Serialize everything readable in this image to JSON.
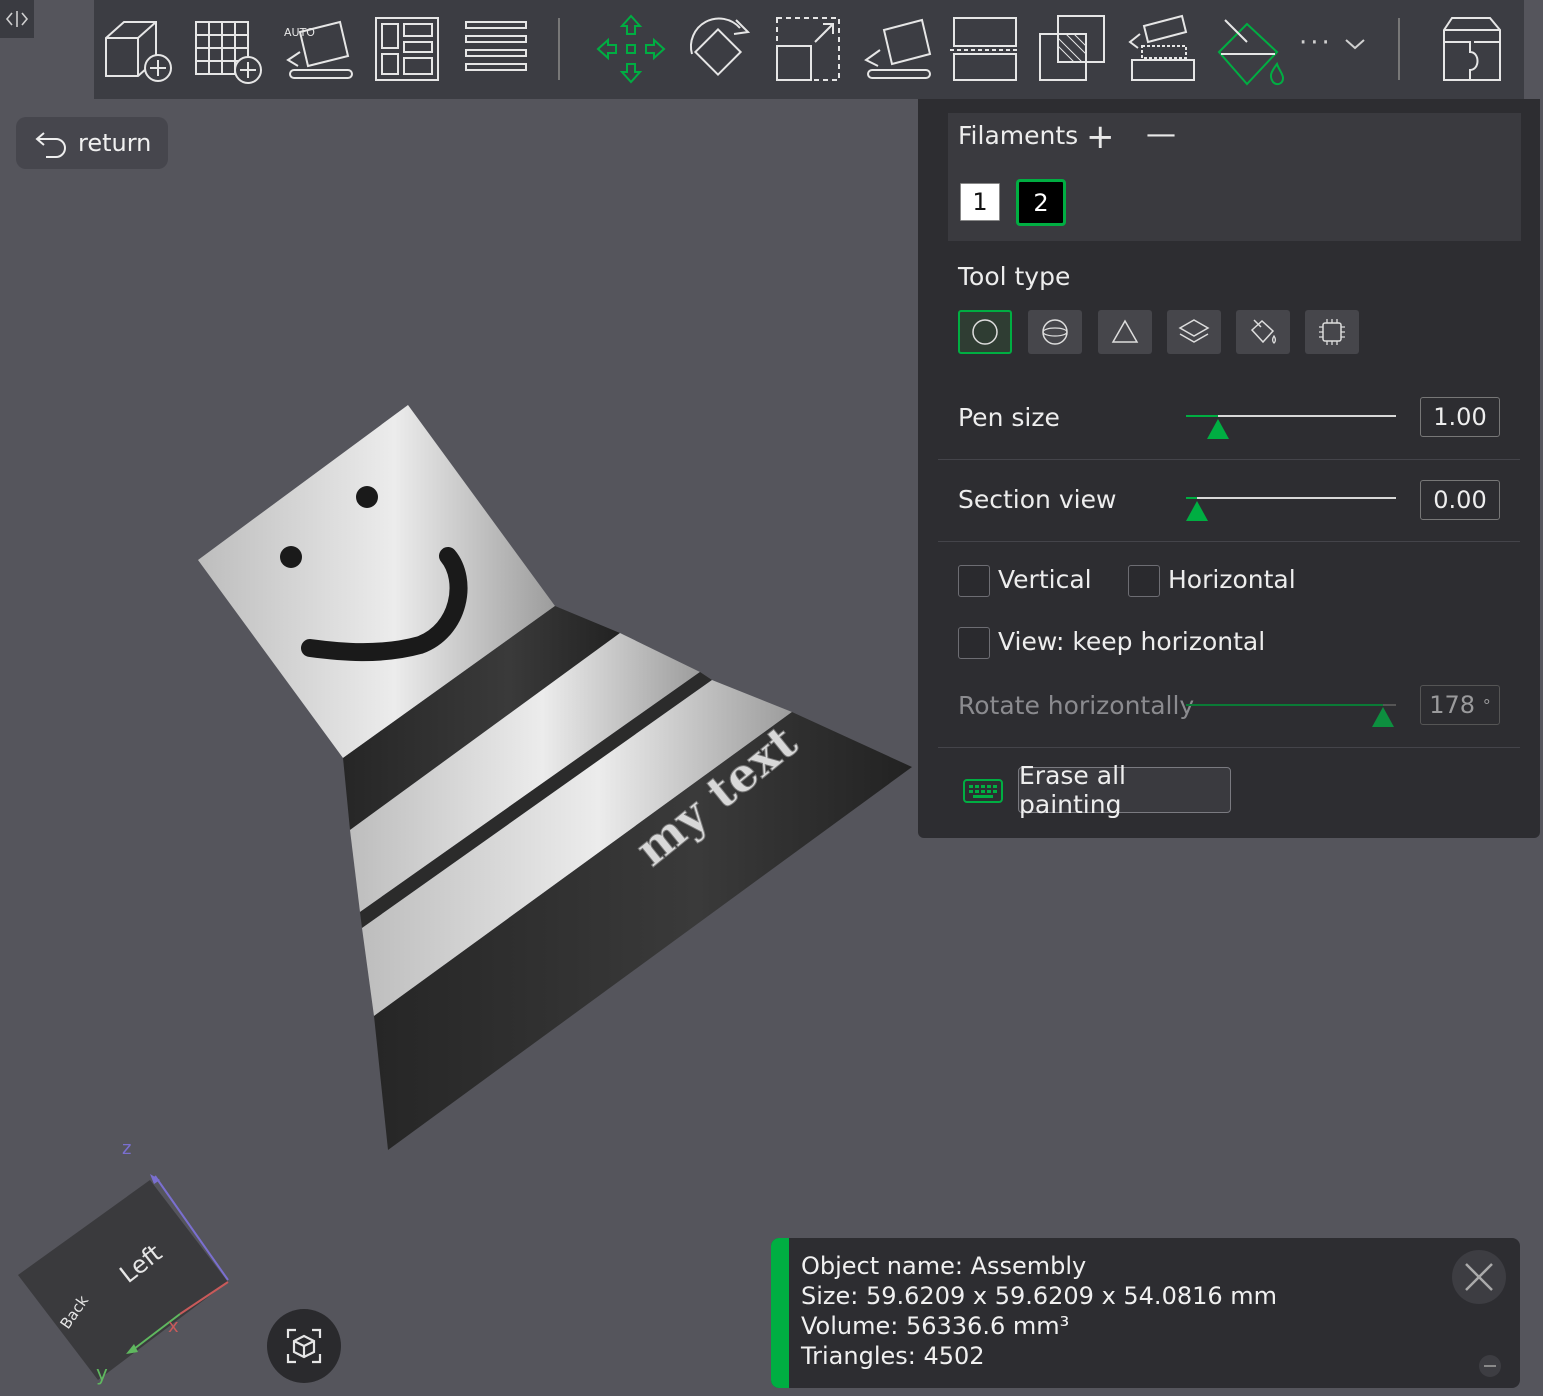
{
  "toolbar": {
    "collapse_icon": "code-toggle-icon",
    "auto_label": "AUTO",
    "more_label": "···"
  },
  "return_button": {
    "label": "return",
    "icon": "undo-arrow-icon"
  },
  "model": {
    "embossed_text": "my text"
  },
  "panel": {
    "filaments": {
      "title": "Filaments",
      "add_label": "+",
      "remove_label": "—",
      "swatches": [
        {
          "label": "1",
          "color": "#ffffff",
          "text_color": "#111111",
          "selected": false
        },
        {
          "label": "2",
          "color": "#000000",
          "text_color": "#ffffff",
          "selected": true
        }
      ]
    },
    "tool_type": {
      "title": "Tool type",
      "tools": [
        "circle-brush-icon",
        "sphere-brush-icon",
        "triangle-icon",
        "layers-height-icon",
        "fill-bucket-icon",
        "gap-fill-chip-icon"
      ],
      "active_index": 0
    },
    "pen_size": {
      "label": "Pen size",
      "value": "1.00",
      "fraction": 0.15
    },
    "section_view": {
      "label": "Section view",
      "value": "0.00",
      "fraction": 0.05
    },
    "vertical": {
      "label": "Vertical",
      "checked": false
    },
    "horizontal": {
      "label": "Horizontal",
      "checked": false
    },
    "keep_horizontal": {
      "label": "View: keep horizontal",
      "checked": false
    },
    "rotate_horizontally": {
      "label": "Rotate horizontally",
      "value": "178",
      "unit": "°",
      "fraction": 0.94
    },
    "erase_all": {
      "label": "Erase all painting",
      "shortcut_icon": "keyboard-icon"
    }
  },
  "info": {
    "object_name": "Object name: Assembly",
    "size": "Size: 59.6209 x 59.6209 x 54.0816 mm",
    "volume": "Volume: 56336.6 mm³",
    "triangles": "Triangles: 4502"
  },
  "view_cube": {
    "face_main": "Left",
    "face_side": "Back",
    "axis_z": "z",
    "axis_x": "x",
    "axis_y": "y"
  },
  "colors": {
    "accent": "#00ae42",
    "background": "#55555c",
    "panel": "#2d2d31",
    "toolbar": "#3c3d43"
  }
}
